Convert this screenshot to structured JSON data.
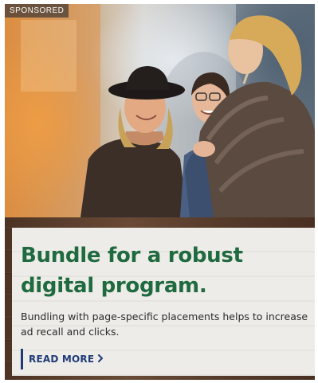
{
  "ad": {
    "badge": "SPONSORED",
    "headline": "Bundle for a robust digital program.",
    "body": "Bundling with page-specific placements helps to increase ad recall and clicks.",
    "cta_label": "READ MORE",
    "icons": {
      "cta": "chevron-right-icon"
    },
    "colors": {
      "headline": "#1f6a3f",
      "cta": "#1e3c78",
      "card_background": "#eeece8",
      "badge_background": "#463c37"
    }
  }
}
